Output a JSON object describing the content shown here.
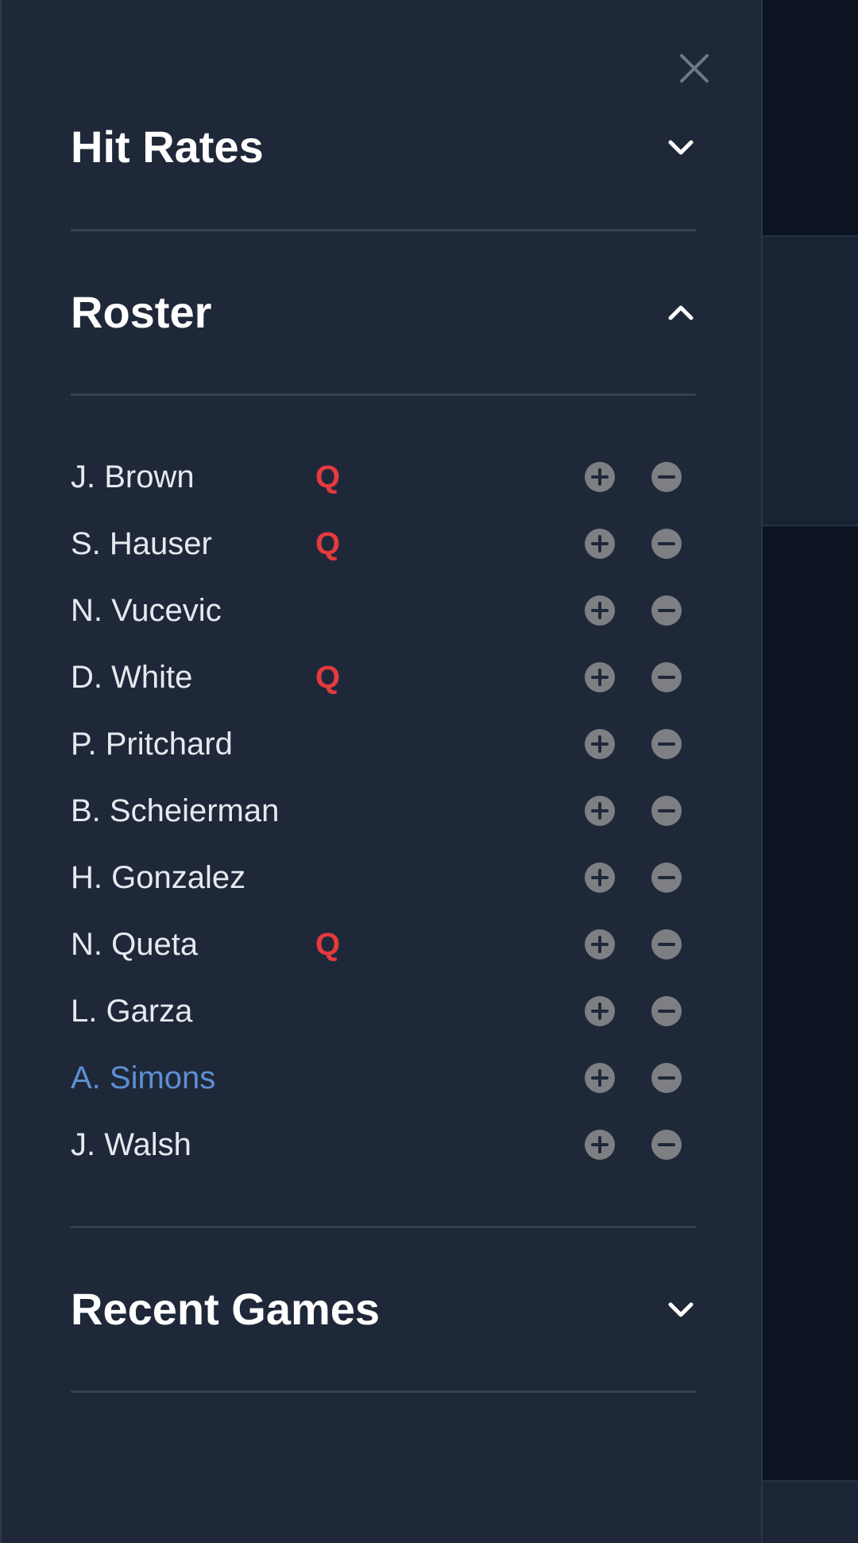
{
  "colors": {
    "drawer_bg": "#1f2839",
    "title_text": "#ffffff",
    "player_text": "#e6e9ef",
    "highlight_text": "#5d8fd2",
    "status_red": "#e53a3e",
    "button_gray": "#7d7f83",
    "divider": "#36404f"
  },
  "drawer": {
    "close_icon": "close-icon",
    "sections": {
      "hit_rates": {
        "title": "Hit Rates",
        "expanded": false,
        "icon": "chevron-down-icon"
      },
      "roster": {
        "title": "Roster",
        "expanded": true,
        "icon": "chevron-up-icon"
      },
      "recent_games": {
        "title": "Recent Games",
        "expanded": false,
        "icon": "chevron-down-icon"
      }
    }
  },
  "roster": {
    "players": [
      {
        "name": "J. Brown",
        "status": "Q",
        "highlighted": false
      },
      {
        "name": "S. Hauser",
        "status": "Q",
        "highlighted": false
      },
      {
        "name": "N. Vucevic",
        "status": "",
        "highlighted": false
      },
      {
        "name": "D. White",
        "status": "Q",
        "highlighted": false
      },
      {
        "name": "P. Pritchard",
        "status": "",
        "highlighted": false
      },
      {
        "name": "B. Scheierman",
        "status": "",
        "highlighted": false
      },
      {
        "name": "H. Gonzalez",
        "status": "",
        "highlighted": false
      },
      {
        "name": "N. Queta",
        "status": "Q",
        "highlighted": false
      },
      {
        "name": "L. Garza",
        "status": "",
        "highlighted": false
      },
      {
        "name": "A. Simons",
        "status": "",
        "highlighted": true
      },
      {
        "name": "J. Walsh",
        "status": "",
        "highlighted": false
      }
    ],
    "add_icon": "plus-circle-icon",
    "remove_icon": "minus-circle-icon"
  }
}
